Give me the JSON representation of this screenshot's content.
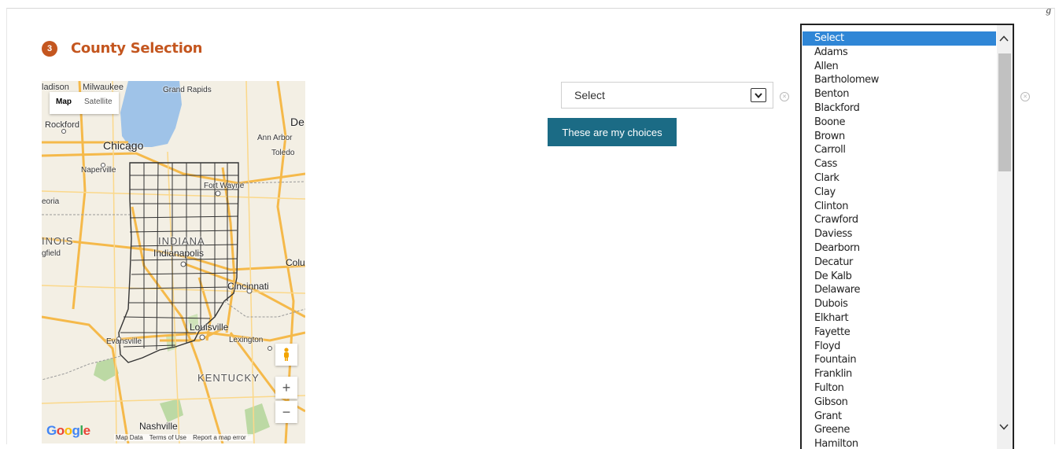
{
  "corner_glyph": "g",
  "section": {
    "step_number": "3",
    "title": "County Selection",
    "accent_color": "#c4561f"
  },
  "map": {
    "type_control": {
      "map_label": "Map",
      "satellite_label": "Satellite",
      "active": "Map"
    },
    "labels": {
      "madison": "ladison",
      "milwaukee": "Milwaukee",
      "grand_rapids": "Grand Rapids",
      "rockford": "Rockford",
      "chicago": "Chicago",
      "detroit": "De",
      "ann_arbor": "Ann Arbor",
      "toledo": "Toledo",
      "naperville": "Naperville",
      "fort_wayne": "Fort Wayne",
      "peoria": "eoria",
      "illinois": "INOIS",
      "springfield": "gfield",
      "indiana": "INDIANA",
      "indianapolis": "Indianapolis",
      "columbus": "Colu",
      "cincinnati": "Cincinnati",
      "louisville": "Louisville",
      "evansville": "Evansville",
      "lexington": "Lexington",
      "kentucky": "KENTUCKY",
      "nashville": "Nashville"
    },
    "footer": {
      "map_data": "Map Data",
      "terms": "Terms of Use",
      "report": "Report a map error"
    },
    "google_logo": [
      "G",
      "o",
      "o",
      "g",
      "l",
      "e"
    ],
    "zoom_in_label": "+",
    "zoom_out_label": "−"
  },
  "county_select": {
    "value": "Select",
    "arrow_icon": "chevron-down-icon"
  },
  "choices_button": {
    "label": "These are my choices",
    "color": "#1b6b85"
  },
  "listbox": {
    "selected": "Select",
    "items": [
      "Select",
      "Adams",
      "Allen",
      "Bartholomew",
      "Benton",
      "Blackford",
      "Boone",
      "Brown",
      "Carroll",
      "Cass",
      "Clark",
      "Clay",
      "Clinton",
      "Crawford",
      "Daviess",
      "Dearborn",
      "Decatur",
      "De Kalb",
      "Delaware",
      "Dubois",
      "Elkhart",
      "Fayette",
      "Floyd",
      "Fountain",
      "Franklin",
      "Fulton",
      "Gibson",
      "Grant",
      "Greene",
      "Hamilton"
    ],
    "highlight_color": "#2f86d6"
  }
}
